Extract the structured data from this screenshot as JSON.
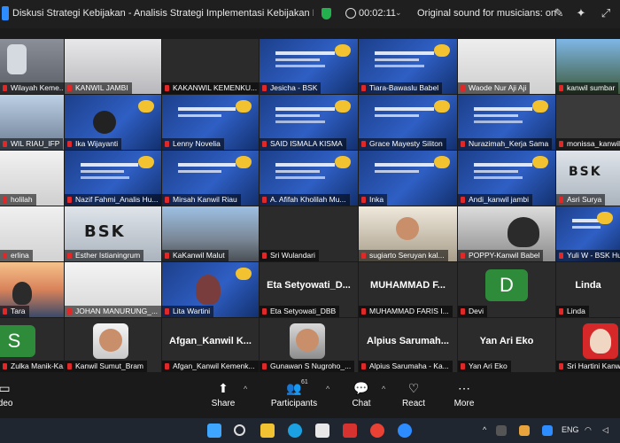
{
  "window": {
    "title": "Diskusi Strategi Kebijakan - Analisis Strategi Implementasi Kebijakan Pe...",
    "timer": "00:02:11",
    "audio_mode": "Original sound for musicians: on"
  },
  "tiles": {
    "r1": [
      "Wilayah Keme...",
      "KANWIL JAMBI",
      "KAKANWIL KEMENKU...",
      "Jesicha - BSK",
      "Tiara-Bawaslu Babel",
      "Waode Nur Aji Aji",
      "kanwil sumbar"
    ],
    "r2": [
      "WIL RIAU_IFP",
      "Ika Wijayanti",
      "Lenny Novelia",
      "SAID ISMALA KISMA",
      "Grace Mayesty Siliton",
      "Nurazimah_Kerja Sama",
      "monissa_kanwil"
    ],
    "r3": [
      "holilah",
      "Nazif Fahmi_Analis Hu...",
      "Mirsah Kanwil Riau",
      "A. Afifah Kholilah Mu...",
      "Inka",
      "Andi_kanwil jambi",
      "Asri Surya"
    ],
    "r4": [
      "erlina",
      "Esther Istianingrum",
      "KaKanwil Malut",
      "Sri Wulandari",
      "sugiarto Seruyan kal...",
      "POPPY-Kanwil Babel",
      "Yuli W - BSK Hu"
    ],
    "r5": [
      "Tara",
      "JOHAN MANURUNG_...",
      "Lita Wartini",
      "Eta Setyowati_DBB",
      "MUHAMMAD FARIS I...",
      "Devi",
      "Linda"
    ],
    "r5_big": [
      "Eta Setyowati_D...",
      "MUHAMMAD F...",
      "D",
      "Linda"
    ],
    "r6": [
      "Zulka Manik-Ka...",
      "Kanwil Sumut_Bram",
      "Afgan_Kanwil Kemenk...",
      "Gunawan S Nugroho_...",
      "Alpius Sarumaha - Ka...",
      "Yan Ari Eko",
      "Sri Hartini Kanw"
    ],
    "r6_big": [
      "S",
      "Afgan_Kanwil K...",
      "Alpius Sarumah...",
      "Yan Ari Eko"
    ]
  },
  "bsk_logo": "BSK",
  "toolbar": {
    "video": "ideo",
    "share": "Share",
    "participants": "Participants",
    "participants_count": "61",
    "chat": "Chat",
    "react": "React",
    "more": "More"
  },
  "taskbar": {
    "lang": "ENG"
  },
  "colors": {
    "avatar_green": "#2e8b3a",
    "zoom_blue": "#2d8cff",
    "muted_red": "#e02828"
  }
}
